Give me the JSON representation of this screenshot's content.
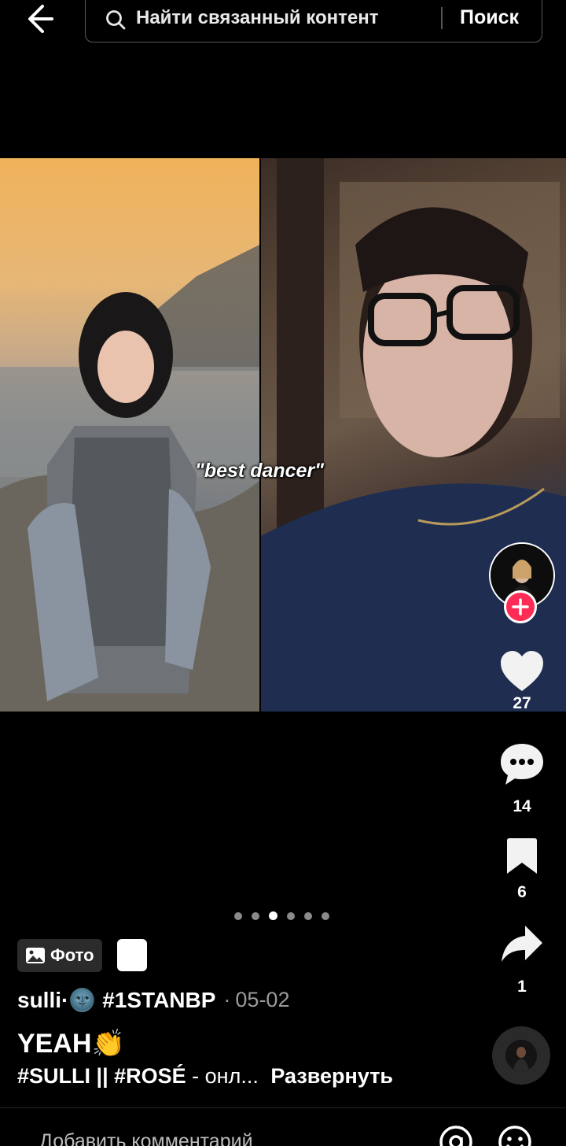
{
  "search": {
    "placeholder": "Найти связанный контент",
    "submit_label": "Поиск"
  },
  "media": {
    "overlay_caption": "\"best dancer\""
  },
  "actions": {
    "likes": "27",
    "comments": "14",
    "saves": "6",
    "shares": "1"
  },
  "pager": {
    "total": 6,
    "active_index": 2
  },
  "post": {
    "badge_label": "Фото",
    "author": "sulli·",
    "author_emoji": "🌚",
    "author_tag": "#1STANBP",
    "date_separator": "·",
    "date": "05-02",
    "title": "YEAH",
    "title_emoji": "👏",
    "tags": "#SULLI || #ROSÉ",
    "desc_rest": "- онл...",
    "expand_label": "Развернуть"
  },
  "comment_bar": {
    "placeholder": "Добавить комментарий"
  },
  "colors": {
    "follow_accent": "#fe2c55",
    "background": "#000000"
  },
  "icons": [
    "back-arrow-icon",
    "search-icon",
    "heart-icon",
    "comment-icon",
    "bookmark-icon",
    "share-icon",
    "image-icon",
    "mention-icon",
    "emoji-icon"
  ]
}
